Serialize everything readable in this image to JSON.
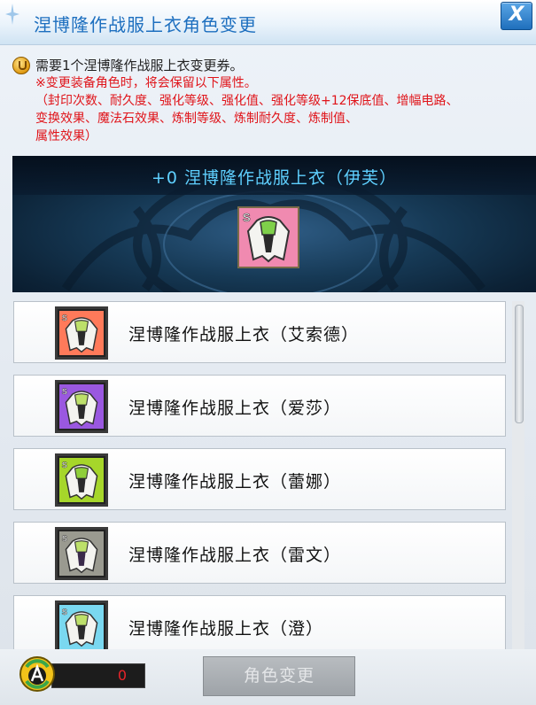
{
  "window": {
    "title": "涅博隆作战服上衣角色变更",
    "close_label": "X"
  },
  "notice": {
    "requirement": "需要1个涅博隆作战服上衣变更券。",
    "warning_lines": [
      "※变更装备角色时，将会保留以下属性。",
      "（封印次数、耐久度、强化等级、强化值、强化等级+12保底值、增幅电路、",
      "变换效果、魔法石效果、炼制等级、炼制耐久度、炼制值、",
      "属性效果）"
    ]
  },
  "current_item": {
    "label": "+0  涅博隆作战服上衣（伊芙）",
    "grade_icon": "S"
  },
  "options": [
    {
      "name": "涅博隆作战服上衣（艾索德）",
      "grade": "S",
      "color": "#ff7a5a"
    },
    {
      "name": "涅博隆作战服上衣（爱莎）",
      "grade": "S",
      "color": "#9a58e0"
    },
    {
      "name": "涅博隆作战服上衣（蕾娜）",
      "grade": "S",
      "color": "#a6d62a"
    },
    {
      "name": "涅博隆作战服上衣（雷文）",
      "grade": "S",
      "color": "#9a9a90"
    },
    {
      "name": "涅博隆作战服上衣（澄）",
      "grade": "S",
      "color": "#7ad8f0"
    }
  ],
  "footer": {
    "ticket_count": "0",
    "change_button_label": "角色变更",
    "change_button_enabled": false
  },
  "colors": {
    "title": "#1d6fbf",
    "warning": "#e0141a",
    "banner_title": "#5fd0ff",
    "counter": "#e8242a"
  }
}
